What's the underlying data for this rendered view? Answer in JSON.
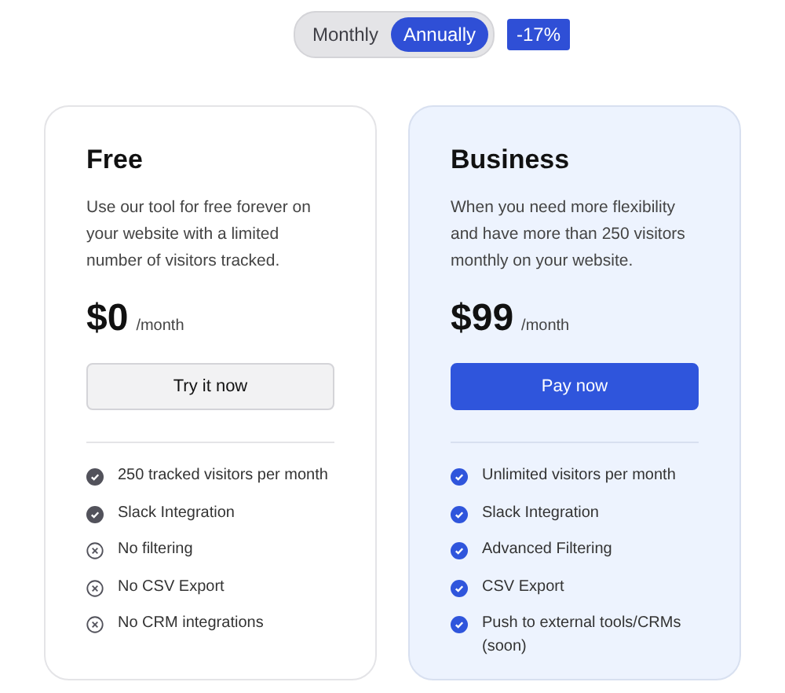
{
  "billing_toggle": {
    "options": [
      {
        "label": "Monthly",
        "selected": false
      },
      {
        "label": "Annually",
        "selected": true
      }
    ],
    "discount_badge": "-17%"
  },
  "plans": [
    {
      "name": "Free",
      "featured": false,
      "description": "Use our tool for free forever on your website with a limited number of visitors tracked.",
      "price": "$0",
      "period": "/month",
      "button": "Try it now",
      "features": [
        {
          "text": "250 tracked visitors per month",
          "included": true
        },
        {
          "text": "Slack Integration",
          "included": true
        },
        {
          "text": "No filtering",
          "included": false
        },
        {
          "text": "No CSV Export",
          "included": false
        },
        {
          "text": "No CRM integrations",
          "included": false
        }
      ]
    },
    {
      "name": "Business",
      "featured": true,
      "description": "When you need more flexibility and have more than 250 visitors monthly on your website.",
      "price": "$99",
      "period": "/month",
      "button": "Pay now",
      "features": [
        {
          "text": "Unlimited visitors per month",
          "included": true
        },
        {
          "text": "Slack Integration",
          "included": true
        },
        {
          "text": "Advanced Filtering",
          "included": true
        },
        {
          "text": "CSV Export",
          "included": true
        },
        {
          "text": "Push to external tools/CRMs (soon)",
          "included": true
        }
      ]
    }
  ]
}
